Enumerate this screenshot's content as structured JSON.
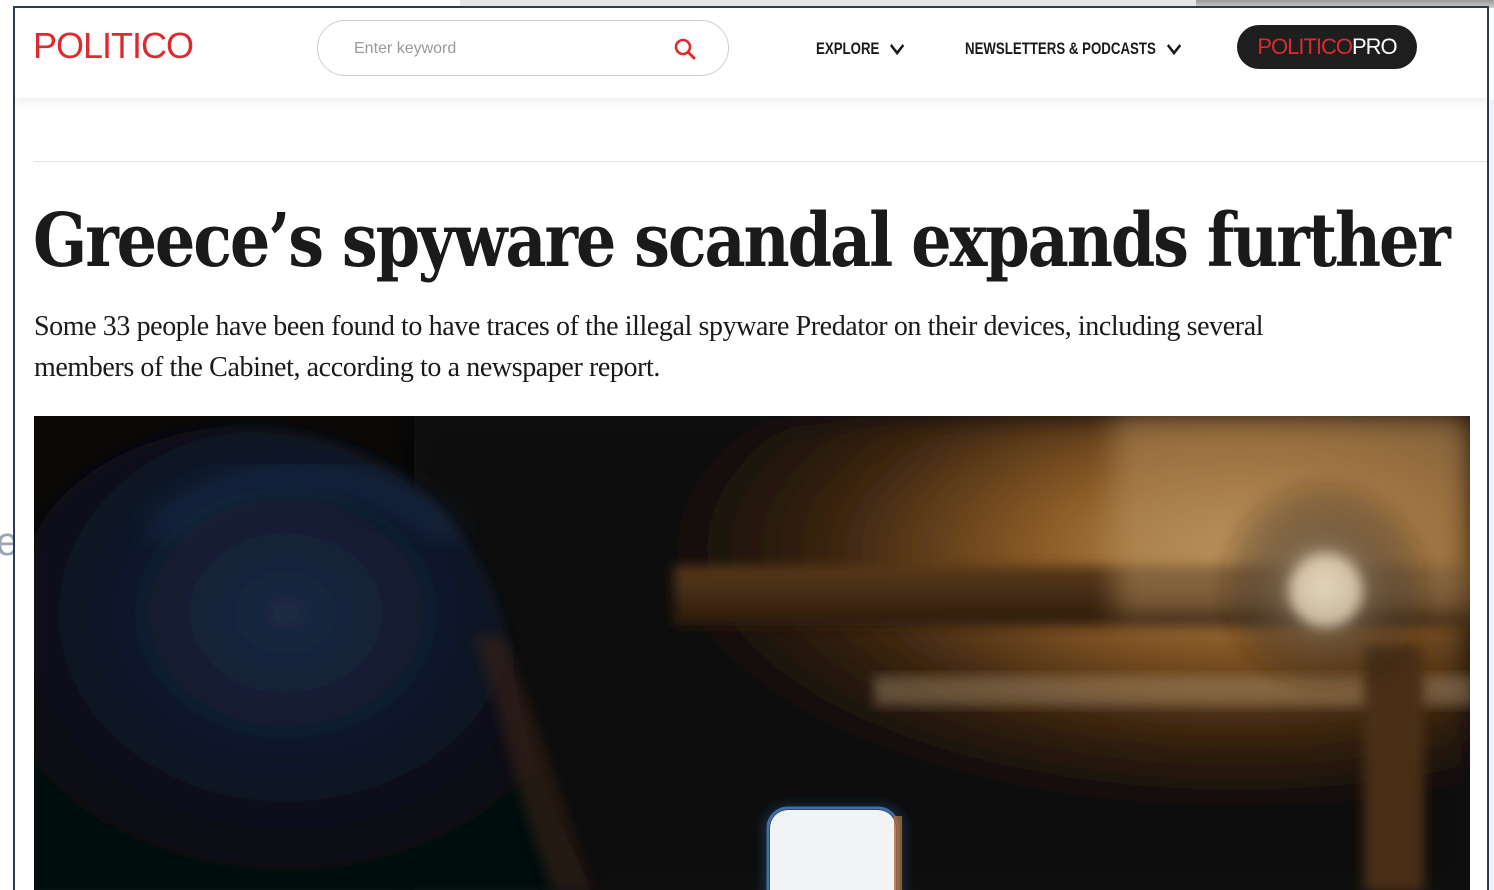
{
  "header": {
    "logo_text": "POLITICO",
    "search": {
      "placeholder": "Enter keyword"
    },
    "nav": [
      {
        "label": "EXPLORE",
        "icon": "chevron-down-icon"
      },
      {
        "label": "NEWSLETTERS & PODCASTS",
        "icon": "chevron-down-icon"
      }
    ],
    "pro_button": {
      "brand": "POLITICO",
      "suffix": "PRO"
    }
  },
  "article": {
    "headline": "Greece’s spyware scandal expands further",
    "dek": "Some 33 people have been found to have traces of the illegal spyware Predator on their devices, including several members of the Cabinet, according to a newspaper report."
  },
  "colors": {
    "brand_red": "#dc2b30",
    "pro_button_bg": "#1e1e1e",
    "text": "#1a1a1a",
    "window_border": "#2b3a55"
  }
}
